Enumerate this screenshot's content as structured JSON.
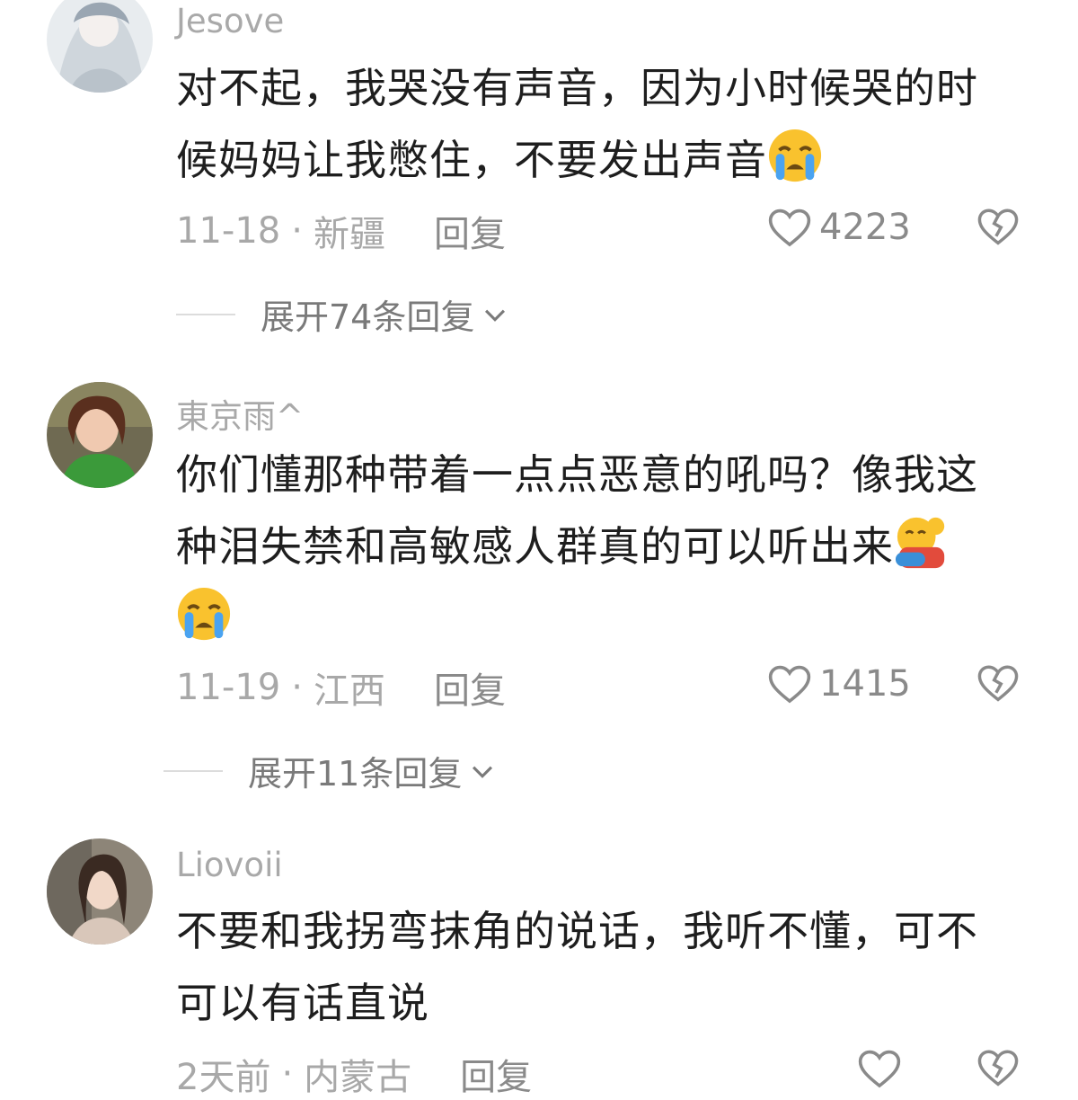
{
  "comments": [
    {
      "username": "Jesove",
      "text_line1": "对不起，我哭没有声音，因为小时候哭的时",
      "text_line2": "候妈妈让我憋住，不要发出声音",
      "date": "11-18",
      "location": "新疆",
      "reply_label": "回复",
      "likes": "4223",
      "expand_label": "展开74条回复",
      "emojis": [
        "crying-face-emoji"
      ]
    },
    {
      "username": "東京雨^",
      "text_line1": "你们懂那种带着一点点恶意的吼吗？像我这",
      "text_line2": "种泪失禁和高敏感人群真的可以听出来",
      "date": "11-19",
      "location": "江西",
      "reply_label": "回复",
      "likes": "1415",
      "expand_label": "展开11条回复",
      "emojis": [
        "hugging-face-emoji",
        "crying-face-emoji"
      ]
    },
    {
      "username": "Liovoii",
      "text_line1": "不要和我拐弯抹角的说话，我听不懂，可不",
      "text_line2": "可以有话直说",
      "date": "2天前",
      "location": "内蒙古",
      "reply_label": "回复",
      "likes": ""
    }
  ],
  "meta_separator": "·",
  "colors": {
    "meta_text": "#a8a8a8",
    "body_text": "#1e1e1e",
    "icon": "#8a8a8a"
  }
}
